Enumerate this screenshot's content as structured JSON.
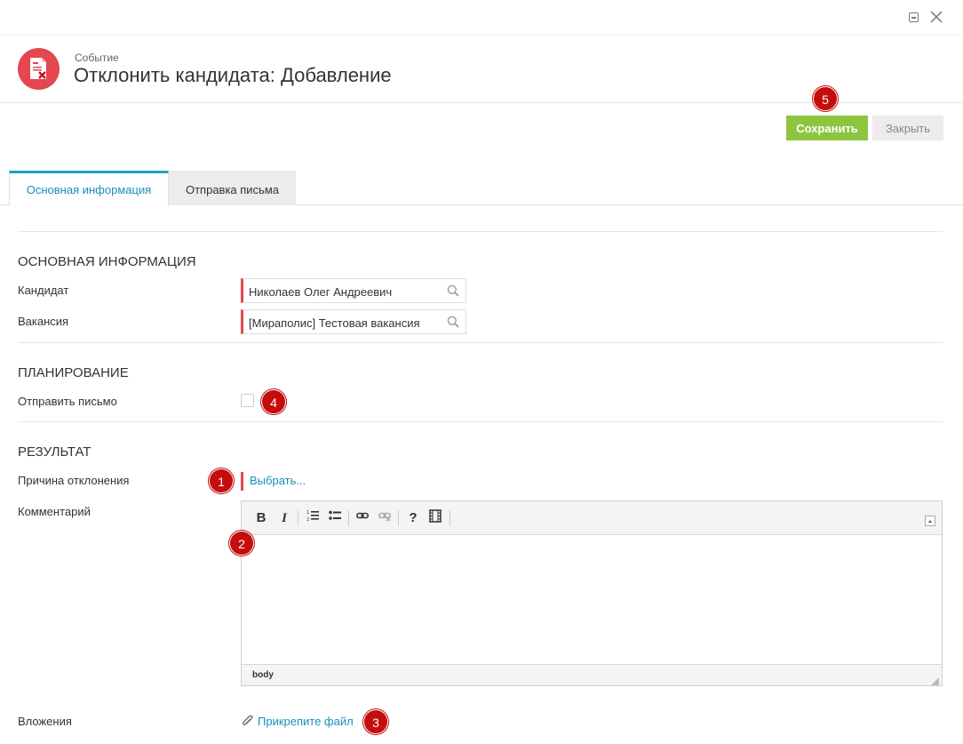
{
  "window": {
    "minimize_icon": "minimize-icon",
    "close_icon": "close-icon"
  },
  "header": {
    "subtitle": "Событие",
    "title": "Отклонить кандидата: Добавление",
    "icon": "reject-document-icon",
    "icon_color": "#e4474f"
  },
  "actions": {
    "save_label": "Сохранить",
    "close_label": "Закрыть",
    "save_color": "#8cc63f"
  },
  "badges": {
    "b1": "1",
    "b2": "2",
    "b3": "3",
    "b4": "4",
    "b5": "5",
    "color": "#c40d0d"
  },
  "tabs": [
    {
      "label": "Основная информация",
      "active": true
    },
    {
      "label": "Отправка письма",
      "active": false
    }
  ],
  "sections": {
    "main": {
      "title": "ОСНОВНАЯ ИНФОРМАЦИЯ",
      "candidate_label": "Кандидат",
      "candidate_value": "Николаев Олег Андреевич",
      "vacancy_label": "Вакансия",
      "vacancy_value": "[Мираполис] Тестовая вакансия"
    },
    "planning": {
      "title": "ПЛАНИРОВАНИЕ",
      "send_mail_label": "Отправить письмо",
      "send_mail_checked": false
    },
    "result": {
      "title": "РЕЗУЛЬТАТ",
      "reason_label": "Причина отклонения",
      "reason_link": "Выбрать...",
      "comment_label": "Комментарий",
      "editor_path": "body",
      "attachments_label": "Вложения",
      "attach_link": "Прикрепите файл"
    }
  },
  "editor_toolbar": [
    "bold-icon",
    "italic-icon",
    "numbered-list-icon",
    "bulleted-list-icon",
    "link-icon",
    "unlink-icon",
    "help-icon",
    "media-icon",
    "collapse-toolbar-icon"
  ],
  "accent_color": "#1aa3c8"
}
